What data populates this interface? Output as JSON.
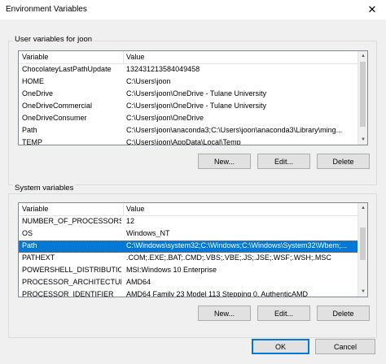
{
  "window": {
    "title": "Environment Variables",
    "close_glyph": "✕"
  },
  "user_vars": {
    "group_label": "User variables for joon",
    "headers": {
      "variable": "Variable",
      "value": "Value"
    },
    "rows": [
      {
        "variable": "ChocolateyLastPathUpdate",
        "value": "132431213584049458"
      },
      {
        "variable": "HOME",
        "value": "C:\\Users\\joon"
      },
      {
        "variable": "OneDrive",
        "value": "C:\\Users\\joon\\OneDrive - Tulane University"
      },
      {
        "variable": "OneDriveCommercial",
        "value": "C:\\Users\\joon\\OneDrive - Tulane University"
      },
      {
        "variable": "OneDriveConsumer",
        "value": "C:\\Users\\joon\\OneDrive"
      },
      {
        "variable": "Path",
        "value": "C:\\Users\\joon\\anaconda3;C:\\Users\\joon\\anaconda3\\Library\\ming..."
      },
      {
        "variable": "TEMP",
        "value": "C:\\Users\\joon\\AppData\\Local\\Temp"
      }
    ],
    "buttons": {
      "new": "New...",
      "edit": "Edit...",
      "delete": "Delete"
    }
  },
  "system_vars": {
    "group_label": "System variables",
    "headers": {
      "variable": "Variable",
      "value": "Value"
    },
    "rows": [
      {
        "variable": "NUMBER_OF_PROCESSORS",
        "value": "12"
      },
      {
        "variable": "OS",
        "value": "Windows_NT"
      },
      {
        "variable": "Path",
        "value": "C:\\Windows\\system32;C:\\Windows;C:\\Windows\\System32\\Wbem;..."
      },
      {
        "variable": "PATHEXT",
        "value": ".COM;.EXE;.BAT;.CMD;.VBS;.VBE;.JS;.JSE;.WSF;.WSH;.MSC"
      },
      {
        "variable": "POWERSHELL_DISTRIBUTIO...",
        "value": "MSI:Windows 10 Enterprise"
      },
      {
        "variable": "PROCESSOR_ARCHITECTURE",
        "value": "AMD64"
      },
      {
        "variable": "PROCESSOR_IDENTIFIER",
        "value": "AMD64 Family 23 Model 113 Stepping 0, AuthenticAMD"
      }
    ],
    "selected_variable": "Path",
    "buttons": {
      "new": "New...",
      "edit": "Edit...",
      "delete": "Delete"
    }
  },
  "footer": {
    "ok": "OK",
    "cancel": "Cancel"
  },
  "colors": {
    "selection": "#0078d7",
    "dialog_bg": "#f0f0f0"
  }
}
